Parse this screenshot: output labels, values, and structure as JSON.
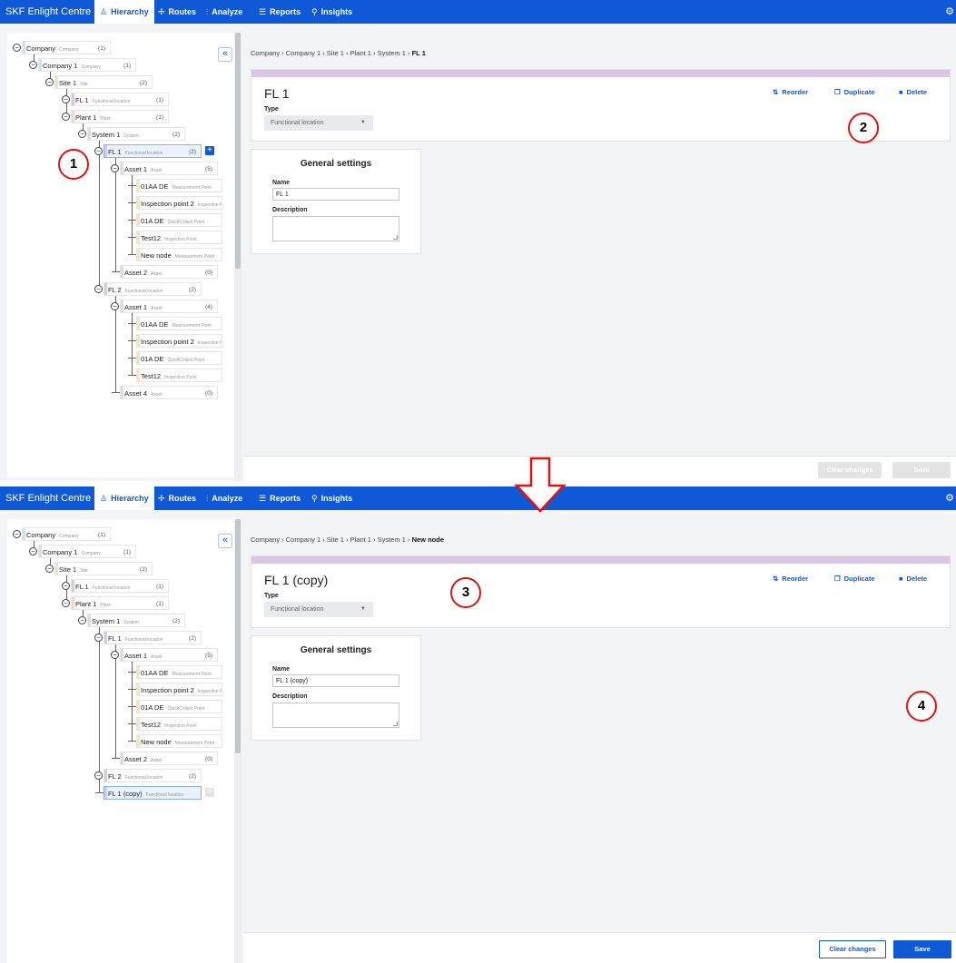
{
  "app": {
    "brand": "SKF Enlight Centre",
    "nav": [
      {
        "label": "Hierarchy",
        "icon": "hierarchy-icon",
        "glyph": "♙"
      },
      {
        "label": "Routes",
        "icon": "routes-icon",
        "glyph": "✢"
      },
      {
        "label": "Analyze",
        "icon": "analyze-icon",
        "glyph": "⫶"
      },
      {
        "label": "Reports",
        "icon": "reports-icon",
        "glyph": "☰"
      },
      {
        "label": "Insights",
        "icon": "insights-icon",
        "glyph": "⚲"
      }
    ],
    "active_tab": "Hierarchy",
    "accent": "#0f58d6"
  },
  "colors": {
    "company": "#c6e9e6",
    "site": "#d7efc2",
    "plant": "#fbd9bb",
    "system": "#dddddd",
    "functional": "#dcc6e8",
    "asset": "#dddddd",
    "point": "#fbe7ad"
  },
  "panel1": {
    "tree": [
      {
        "name": "Company",
        "type": "Company",
        "count": "(1)",
        "cat": "company"
      },
      {
        "name": "Company 1",
        "type": "Company",
        "count": "(1)",
        "cat": "company"
      },
      {
        "name": "Site 1",
        "type": "Site",
        "count": "(2)",
        "cat": "site"
      },
      {
        "name": "FL 1",
        "type": "Functional location",
        "count": "(1)",
        "cat": "functional"
      },
      {
        "name": "Plant 1",
        "type": "Plant",
        "count": "(1)",
        "cat": "plant"
      },
      {
        "name": "System 1",
        "type": "System",
        "count": "(2)",
        "cat": "system"
      },
      {
        "name": "FL 1",
        "type": "Functional location",
        "count": "(2)",
        "cat": "functional"
      },
      {
        "name": "Asset 1",
        "type": "Asset",
        "count": "(5)",
        "cat": "asset"
      },
      {
        "name": "01AA DE",
        "type": "Measurement Point",
        "count": "",
        "cat": "point"
      },
      {
        "name": "Inspection point 2",
        "type": "Inspection Point",
        "count": "",
        "cat": "point"
      },
      {
        "name": "01A DE",
        "type": "QuickCollect Point",
        "count": "",
        "cat": "point"
      },
      {
        "name": "Test12",
        "type": "Inspection Point",
        "count": "",
        "cat": "point"
      },
      {
        "name": "New node",
        "type": "Measurement Point",
        "count": "",
        "cat": "point"
      },
      {
        "name": "Asset 2",
        "type": "Asset",
        "count": "(0)",
        "cat": "asset"
      },
      {
        "name": "FL 2",
        "type": "Functional location",
        "count": "(2)",
        "cat": "functional"
      },
      {
        "name": "Asset 1",
        "type": "Asset",
        "count": "(4)",
        "cat": "asset"
      },
      {
        "name": "01AA DE",
        "type": "Measurement Point",
        "count": "",
        "cat": "point"
      },
      {
        "name": "Inspection point 2",
        "type": "Inspection Point",
        "count": "",
        "cat": "point"
      },
      {
        "name": "01A DE",
        "type": "QuickCollect Point",
        "count": "",
        "cat": "point"
      },
      {
        "name": "Test12",
        "type": "Inspection Point",
        "count": "",
        "cat": "point"
      },
      {
        "name": "Asset 4",
        "type": "Asset",
        "count": "(0)",
        "cat": "asset"
      }
    ],
    "breadcrumb": {
      "path": "Company  ›  Company 1  ›  Site 1  ›  Plant 1  ›  System 1  ›",
      "current": "FL 1"
    },
    "header": {
      "title": "FL 1",
      "type_label": "Type",
      "type_value": "Functional location"
    },
    "actions": {
      "reorder": "Reorder",
      "duplicate": "Duplicate",
      "delete": "Delete"
    },
    "general": {
      "title": "General settings",
      "name_label": "Name",
      "name_value": "FL 1",
      "desc_label": "Description"
    },
    "buttons": {
      "clear": "Clear changes",
      "save": "Save"
    }
  },
  "panel2": {
    "tree": [
      {
        "name": "Company",
        "type": "Company",
        "count": "(1)",
        "cat": "company"
      },
      {
        "name": "Company 1",
        "type": "Company",
        "count": "(1)",
        "cat": "company"
      },
      {
        "name": "Site 1",
        "type": "Site",
        "count": "(2)",
        "cat": "site"
      },
      {
        "name": "FL 1",
        "type": "Functional location",
        "count": "(1)",
        "cat": "functional"
      },
      {
        "name": "Plant 1",
        "type": "Plant",
        "count": "(1)",
        "cat": "plant"
      },
      {
        "name": "System 1",
        "type": "System",
        "count": "(2)",
        "cat": "system"
      },
      {
        "name": "FL 1",
        "type": "Functional location",
        "count": "(2)",
        "cat": "functional"
      },
      {
        "name": "Asset 1",
        "type": "Asset",
        "count": "(5)",
        "cat": "asset"
      },
      {
        "name": "01AA DE",
        "type": "Measurement Point",
        "count": "",
        "cat": "point"
      },
      {
        "name": "Inspection point 2",
        "type": "Inspection Point",
        "count": "",
        "cat": "point"
      },
      {
        "name": "01A DE",
        "type": "QuickCollect Point",
        "count": "",
        "cat": "point"
      },
      {
        "name": "Test12",
        "type": "Inspection Point",
        "count": "",
        "cat": "point"
      },
      {
        "name": "New node",
        "type": "Measurement Point",
        "count": "",
        "cat": "point"
      },
      {
        "name": "Asset 2",
        "type": "Asset",
        "count": "(0)",
        "cat": "asset"
      },
      {
        "name": "FL 2",
        "type": "Functional location",
        "count": "(2)",
        "cat": "functional"
      },
      {
        "name": "FL 1 (copy)",
        "type": "Functional location",
        "count": "",
        "cat": "functional"
      }
    ],
    "breadcrumb": {
      "path": "Company  ›  Company 1  ›  Site 1  ›  Plant 1  ›  System 1  ›",
      "current": "New node"
    },
    "header": {
      "title": "FL 1 (copy)",
      "type_label": "Type",
      "type_value": "Functional location"
    },
    "actions": {
      "reorder": "Reorder",
      "duplicate": "Duplicate",
      "delete": "Delete"
    },
    "general": {
      "title": "General settings",
      "name_label": "Name",
      "name_value": "FL 1 (copy)",
      "desc_label": "Description"
    },
    "buttons": {
      "clear": "Clear changes",
      "save": "Save"
    }
  },
  "markers": [
    "1",
    "2",
    "3",
    "4"
  ]
}
